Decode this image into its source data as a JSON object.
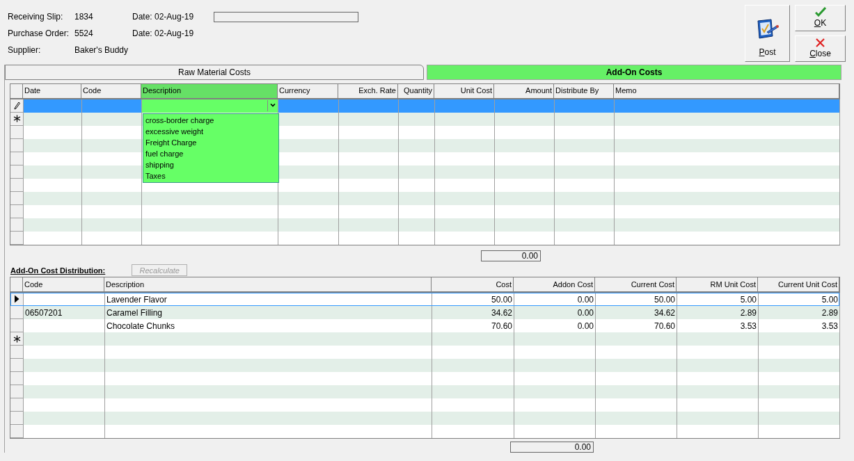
{
  "header": {
    "fields": [
      {
        "label": "Receiving Slip:",
        "value": "1834",
        "date": "Date: 02-Aug-19"
      },
      {
        "label": "Purchase Order:",
        "value": "5524",
        "date": "Date: 02-Aug-19"
      },
      {
        "label": "Supplier:",
        "value": "Baker's Buddy"
      }
    ]
  },
  "buttons": [
    {
      "kind": "post",
      "label": "Post"
    },
    {
      "kind": "ok",
      "label": "OK"
    },
    {
      "kind": "close",
      "label": "Close"
    }
  ],
  "tabs": [
    {
      "label": "Raw Material Costs",
      "selected": false
    },
    {
      "label": "Add-On Costs",
      "selected": true
    }
  ],
  "addon_grid": {
    "columns": [
      {
        "label": "Date",
        "selected": false
      },
      {
        "label": "Code",
        "selected": false
      },
      {
        "label": "Description",
        "selected": true
      },
      {
        "label": "Currency",
        "selected": false
      },
      {
        "label": "Exch. Rate",
        "selected": false
      },
      {
        "label": "Quantity",
        "selected": false
      },
      {
        "label": "Unit Cost",
        "selected": false
      },
      {
        "label": "Amount",
        "selected": false
      },
      {
        "label": "Distribute By",
        "selected": false
      },
      {
        "label": "Memo",
        "selected": false
      }
    ],
    "rows": [
      {
        "kind": "edit",
        "selected": true
      },
      {
        "kind": "new",
        "selected": false
      },
      {
        "kind": "none",
        "selected": false
      },
      {
        "kind": "none",
        "selected": false
      },
      {
        "kind": "none",
        "selected": false
      },
      {
        "kind": "none",
        "selected": false
      },
      {
        "kind": "none",
        "selected": false
      },
      {
        "kind": "none",
        "selected": false
      },
      {
        "kind": "none",
        "selected": false
      },
      {
        "kind": "none",
        "selected": false
      },
      {
        "kind": "none",
        "selected": false
      }
    ],
    "dropdown": [
      "cross-border charge",
      "excessive weight",
      "Freight Charge",
      "fuel charge",
      "shipping",
      "Taxes"
    ],
    "total": "0.00"
  },
  "distribution": {
    "title": "Add-On Cost Distribution:",
    "recalculate": {
      "label": "Recalculate",
      "disabled": true
    },
    "columns": [
      "Code",
      "Description",
      "Cost",
      "Addon Cost",
      "Current Cost",
      "RM Unit Cost",
      "Current Unit Cost"
    ],
    "rows": [
      {
        "kind": "current",
        "selected": true,
        "cells": [
          "",
          "Lavender Flavor",
          "50.00",
          "0.00",
          "50.00",
          "5.00",
          "5.00"
        ]
      },
      {
        "kind": "none",
        "selected": false,
        "cells": [
          "06507201",
          "Caramel Filling",
          "34.62",
          "0.00",
          "34.62",
          "2.89",
          "2.89"
        ]
      },
      {
        "kind": "none",
        "selected": false,
        "cells": [
          "",
          "Chocolate Chunks",
          "70.60",
          "0.00",
          "70.60",
          "3.53",
          "3.53"
        ]
      },
      {
        "kind": "new",
        "selected": false
      },
      {
        "kind": "none",
        "selected": false
      },
      {
        "kind": "none",
        "selected": false
      },
      {
        "kind": "none",
        "selected": false
      },
      {
        "kind": "none",
        "selected": false
      },
      {
        "kind": "none",
        "selected": false
      },
      {
        "kind": "none",
        "selected": false
      },
      {
        "kind": "none",
        "selected": false
      }
    ],
    "total": "0.00"
  }
}
